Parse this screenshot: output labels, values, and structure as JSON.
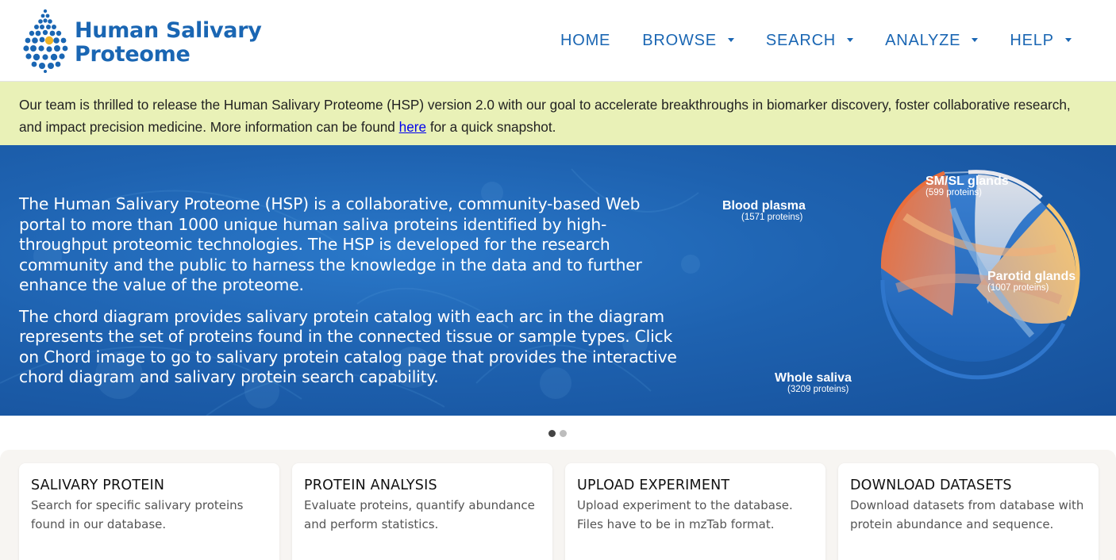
{
  "logo": {
    "line1": "Human Salivary",
    "line2": "Proteome",
    "icon": "droplet-dots-icon",
    "brand_color": "#1a66b3",
    "accent": "#f0b323"
  },
  "nav": [
    {
      "label": "HOME",
      "dropdown": false
    },
    {
      "label": "BROWSE",
      "dropdown": true
    },
    {
      "label": "SEARCH",
      "dropdown": true
    },
    {
      "label": "ANALYZE",
      "dropdown": true
    },
    {
      "label": "HELP",
      "dropdown": true
    }
  ],
  "announcement": {
    "before_link": "Our team is thrilled to release the Human Salivary Proteome (HSP) version 2.0 with our goal to accelerate breakthroughs in biomarker discovery, foster collaborative research, and impact precision medicine. More information can be found ",
    "link": "here",
    "after_link": " for a quick snapshot.",
    "background": "#e9f1b7"
  },
  "hero": {
    "paragraph1": "The Human Salivary Proteome (HSP) is a collaborative, community-based Web portal to more than 1000 unique human saliva proteins identified by high-throughput proteomic technologies. The HSP is developed for the research community and the public to harness the knowledge in the data and to further enhance the value of the proteome.",
    "paragraph2": "The chord diagram provides salivary protein catalog with each arc in the diagram represents the set of proteins found in the connected tissue or sample types. Click on Chord image to go to salivary protein catalog page that provides the interactive chord diagram and salivary protein search capability.",
    "chord": {
      "sm_sl": {
        "name": "SM/SL glands",
        "count": "(599 proteins)"
      },
      "blood": {
        "name": "Blood plasma",
        "count": "(1571 proteins)"
      },
      "parotid": {
        "name": "Parotid glands",
        "count": "(1007 proteins)"
      },
      "whole": {
        "name": "Whole saliva",
        "count": "(3209 proteins)"
      }
    }
  },
  "carousel": {
    "slides": 2,
    "active": 1
  },
  "cards": [
    {
      "title": "SALIVARY PROTEIN",
      "desc": "Search for specific salivary proteins found in our database."
    },
    {
      "title": "PROTEIN ANALYSIS",
      "desc": "Evaluate proteins, quantify abundance and perform statistics."
    },
    {
      "title": "UPLOAD EXPERIMENT",
      "desc": "Upload experiment to the database. Files have to be in mzTab format."
    },
    {
      "title": "DOWNLOAD DATASETS",
      "desc": "Download datasets from database with protein abundance and sequence."
    }
  ]
}
